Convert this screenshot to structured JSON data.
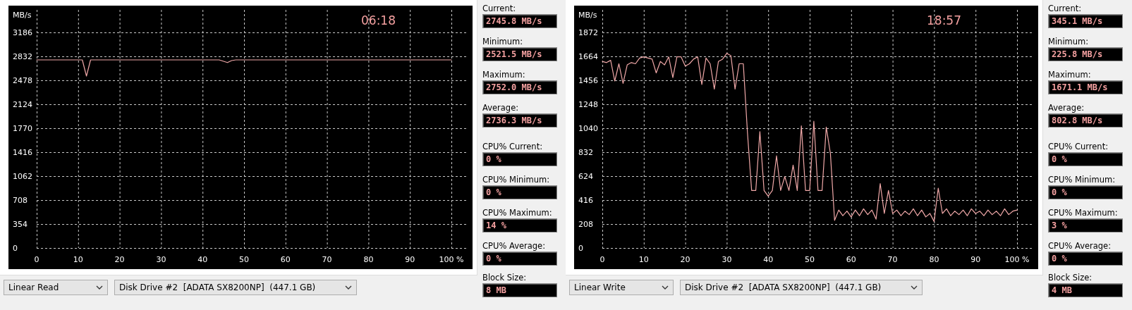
{
  "panels": [
    {
      "timer": "06:18",
      "chart_data": {
        "type": "line",
        "ylabel": "MB/s",
        "x": [
          0,
          2,
          4,
          6,
          8,
          10,
          11,
          12,
          13,
          14,
          16,
          18,
          20,
          22,
          24,
          26,
          28,
          30,
          32,
          34,
          36,
          38,
          40,
          42,
          44,
          46,
          47,
          48,
          50,
          52,
          54,
          56,
          58,
          60,
          62,
          64,
          66,
          68,
          70,
          72,
          74,
          76,
          78,
          80,
          82,
          84,
          86,
          88,
          90,
          92,
          94,
          96,
          98,
          100
        ],
        "series": [
          {
            "color": "#f0a8a8",
            "values": [
              2780,
              2780,
              2780,
              2780,
              2780,
              2780,
              2780,
              2540,
              2780,
              2780,
              2780,
              2780,
              2780,
              2780,
              2780,
              2780,
              2780,
              2780,
              2780,
              2780,
              2780,
              2780,
              2780,
              2780,
              2780,
              2740,
              2770,
              2780,
              2780,
              2780,
              2780,
              2780,
              2780,
              2780,
              2780,
              2780,
              2780,
              2780,
              2780,
              2780,
              2780,
              2780,
              2780,
              2780,
              2780,
              2780,
              2780,
              2780,
              2780,
              2780,
              2780,
              2780,
              2780,
              2780
            ]
          }
        ],
        "xlim": [
          0,
          100
        ],
        "ylim": [
          0,
          3540
        ],
        "xticks": [
          0,
          10,
          20,
          30,
          40,
          50,
          60,
          70,
          80,
          90,
          {
            "value": 100,
            "label": "100 %"
          }
        ],
        "yticks": [
          0,
          354,
          708,
          1062,
          1416,
          1770,
          2124,
          2478,
          2832,
          3186
        ],
        "grid": true
      },
      "stats": [
        [
          {
            "label": "Current:",
            "value": "2745.8 MB/s"
          },
          {
            "label": "Minimum:",
            "value": "2521.5 MB/s"
          },
          {
            "label": "Maximum:",
            "value": "2752.0 MB/s"
          },
          {
            "label": "Average:",
            "value": "2736.3 MB/s"
          }
        ],
        [
          {
            "label": "CPU% Current:",
            "value": "0 %"
          },
          {
            "label": "CPU% Minimum:",
            "value": "0 %"
          },
          {
            "label": "CPU% Maximum:",
            "value": "14 %"
          },
          {
            "label": "CPU% Average:",
            "value": "0 %"
          }
        ],
        [
          {
            "label": "Block Size:",
            "value": "8 MB"
          }
        ]
      ],
      "test_select": "Linear Read",
      "drive_select": "Disk Drive #2  [ADATA SX8200NP]  (447.1 GB)"
    },
    {
      "timer": "18:57",
      "chart_data": {
        "type": "line",
        "ylabel": "MB/s",
        "x": [
          0,
          1,
          2,
          3,
          4,
          5,
          6,
          7,
          8,
          9,
          10,
          11,
          12,
          13,
          14,
          15,
          16,
          17,
          18,
          19,
          20,
          21,
          22,
          23,
          24,
          25,
          26,
          27,
          28,
          29,
          30,
          31,
          32,
          33,
          34,
          35,
          36,
          37,
          38,
          39,
          40,
          41,
          42,
          43,
          44,
          45,
          46,
          47,
          48,
          49,
          50,
          51,
          52,
          53,
          54,
          55,
          56,
          57,
          58,
          59,
          60,
          61,
          62,
          63,
          64,
          65,
          66,
          67,
          68,
          69,
          70,
          71,
          72,
          73,
          74,
          75,
          76,
          77,
          78,
          79,
          80,
          81,
          82,
          83,
          84,
          85,
          86,
          87,
          88,
          89,
          90,
          91,
          92,
          93,
          94,
          95,
          96,
          97,
          98,
          99,
          100
        ],
        "series": [
          {
            "color": "#f0a8a8",
            "values": [
              1620,
              1610,
              1630,
              1450,
              1600,
              1430,
              1590,
              1610,
              1600,
              1650,
              1660,
              1650,
              1640,
              1520,
              1620,
              1590,
              1660,
              1480,
              1660,
              1660,
              1580,
              1600,
              1640,
              1660,
              1420,
              1650,
              1600,
              1380,
              1620,
              1640,
              1690,
              1670,
              1380,
              1600,
              1600,
              1000,
              500,
              500,
              1010,
              500,
              450,
              500,
              800,
              500,
              620,
              500,
              720,
              500,
              1060,
              500,
              500,
              1100,
              500,
              500,
              1050,
              820,
              240,
              330,
              280,
              320,
              270,
              330,
              280,
              340,
              290,
              330,
              250,
              560,
              300,
              500,
              300,
              330,
              280,
              320,
              290,
              340,
              280,
              330,
              270,
              300,
              230,
              520,
              300,
              340,
              280,
              320,
              290,
              330,
              280,
              340,
              300,
              320,
              280,
              330,
              290,
              320,
              280,
              340,
              290,
              320,
              330
            ]
          }
        ],
        "xlim": [
          0,
          100
        ],
        "ylim": [
          0,
          2080
        ],
        "xticks": [
          0,
          10,
          20,
          30,
          40,
          50,
          60,
          70,
          80,
          90,
          {
            "value": 100,
            "label": "100 %"
          }
        ],
        "yticks": [
          0,
          208,
          416,
          624,
          832,
          1040,
          1248,
          1456,
          1664,
          1872
        ],
        "grid": true
      },
      "stats": [
        [
          {
            "label": "Current:",
            "value": "345.1 MB/s"
          },
          {
            "label": "Minimum:",
            "value": "225.8 MB/s"
          },
          {
            "label": "Maximum:",
            "value": "1671.1 MB/s"
          },
          {
            "label": "Average:",
            "value": "802.8 MB/s"
          }
        ],
        [
          {
            "label": "CPU% Current:",
            "value": "0 %"
          },
          {
            "label": "CPU% Minimum:",
            "value": "0 %"
          },
          {
            "label": "CPU% Maximum:",
            "value": "3 %"
          },
          {
            "label": "CPU% Average:",
            "value": "0 %"
          }
        ],
        [
          {
            "label": "Block Size:",
            "value": "4 MB"
          }
        ]
      ],
      "test_select": "Linear Write",
      "drive_select": "Disk Drive #2  [ADATA SX8200NP]  (447.1 GB)"
    }
  ]
}
